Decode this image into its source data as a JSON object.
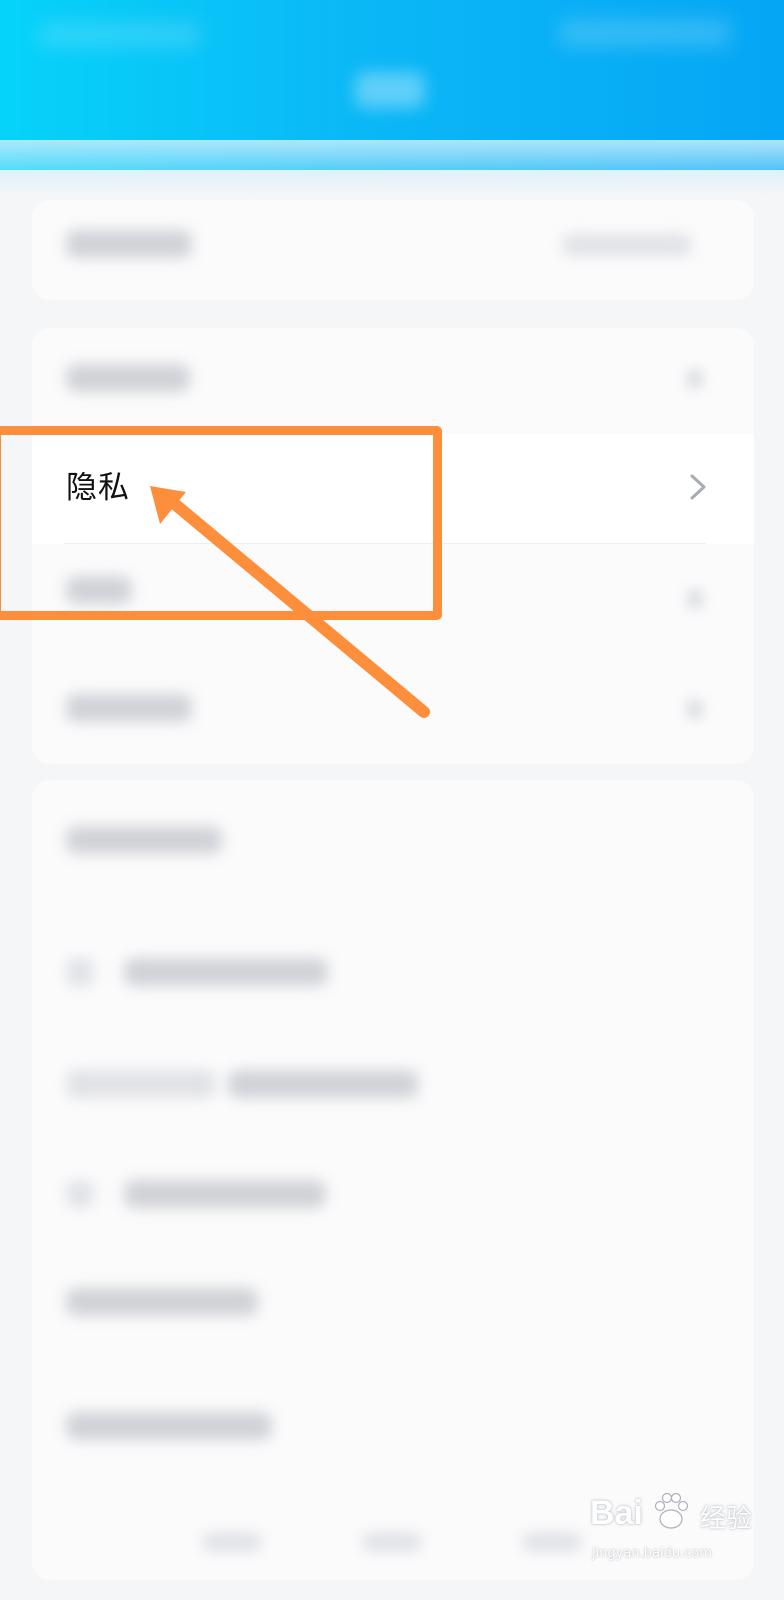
{
  "settings_item": {
    "label": "隐私"
  },
  "watermark": {
    "brand": "Bai",
    "brand_suffix": "经验",
    "url": "jingyan.baidu.com"
  },
  "colors": {
    "header": "#0bb8f6",
    "highlight": "#fd8e3c",
    "chevron": "#a8abb3"
  },
  "icons": {
    "chevron": "chevron-right-icon",
    "arrow": "annotation-arrow",
    "paw": "baidu-paw-icon"
  }
}
